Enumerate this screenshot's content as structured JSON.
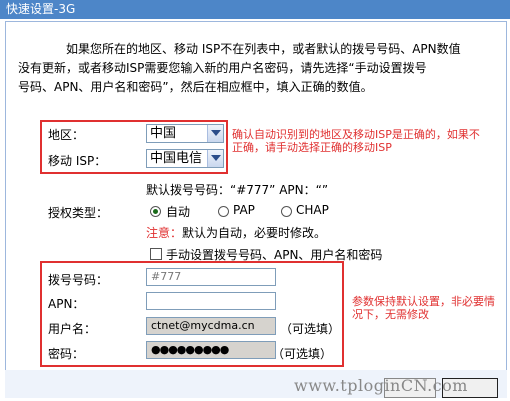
{
  "window": {
    "title": "快速设置-3G"
  },
  "intro": {
    "line1": "如果您所在的地区、移动 ISP不在列表中，或者默认的拨号号码、APN数值",
    "line2": "没有更新，或者移动ISP需要您输入新的用户名密码，请先选择“手动设置拨号",
    "line3": "号码、APN、用户名和密码”，然后在相应框中，填入正确的数值。"
  },
  "region": {
    "label": "地区：",
    "value": "中国"
  },
  "isp": {
    "label": "移动 ISP：",
    "value": "中国电信"
  },
  "note_confirm": {
    "line1": "确认自动识别到的地区及移动ISP是正确的，如果不",
    "line2": "正确，请手动选择正确的移动ISP"
  },
  "defaults": {
    "text": "默认拨号号码：“#777” APN：“”"
  },
  "auth": {
    "label": "授权类型：",
    "options": [
      "自动",
      "PAP",
      "CHAP"
    ],
    "selected": "自动",
    "note": "注意：默认为自动，必要时修改。"
  },
  "manual": {
    "label": "手动设置拨号号码、APN、用户名和密码",
    "checked": false
  },
  "fields": {
    "dial": {
      "label": "拨号号码：",
      "placeholder": "#777"
    },
    "apn": {
      "label": "APN：",
      "value": ""
    },
    "username": {
      "label": "用户名：",
      "value": "ctnet@mycdma.cn",
      "optional": "（可选填）"
    },
    "password": {
      "label": "密码：",
      "value": "●●●●●●●●●",
      "optional": "（可选填）"
    }
  },
  "note_keep": {
    "line1": "参数保持默认设置，非必要情",
    "line2": "况下，无需修改"
  },
  "watermark": {
    "text": "www.tploginCN.com"
  },
  "colors": {
    "title_bar": "#4d86c8",
    "highlight": "#e03030",
    "input_filled": "#d6d3ce"
  }
}
